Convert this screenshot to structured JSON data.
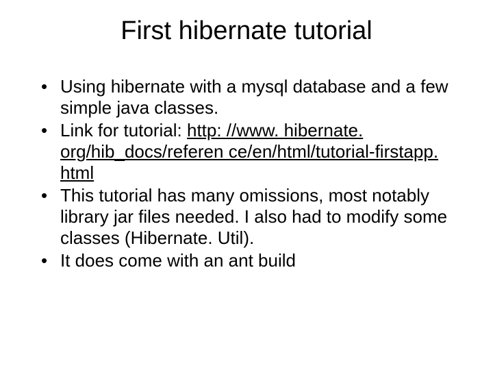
{
  "title": "First hibernate tutorial",
  "bullets": [
    {
      "text": "Using hibernate with a mysql database and a few simple java classes."
    },
    {
      "prefix": "Link for tutorial: ",
      "link": "http: //www. hibernate. org/hib_docs/referen ce/en/html/tutorial-firstapp. html"
    },
    {
      "text": "This tutorial has many omissions, most notably library jar files needed. I also had to modify some classes (Hibernate. Util)."
    },
    {
      "text": "It does come with an ant build"
    }
  ]
}
